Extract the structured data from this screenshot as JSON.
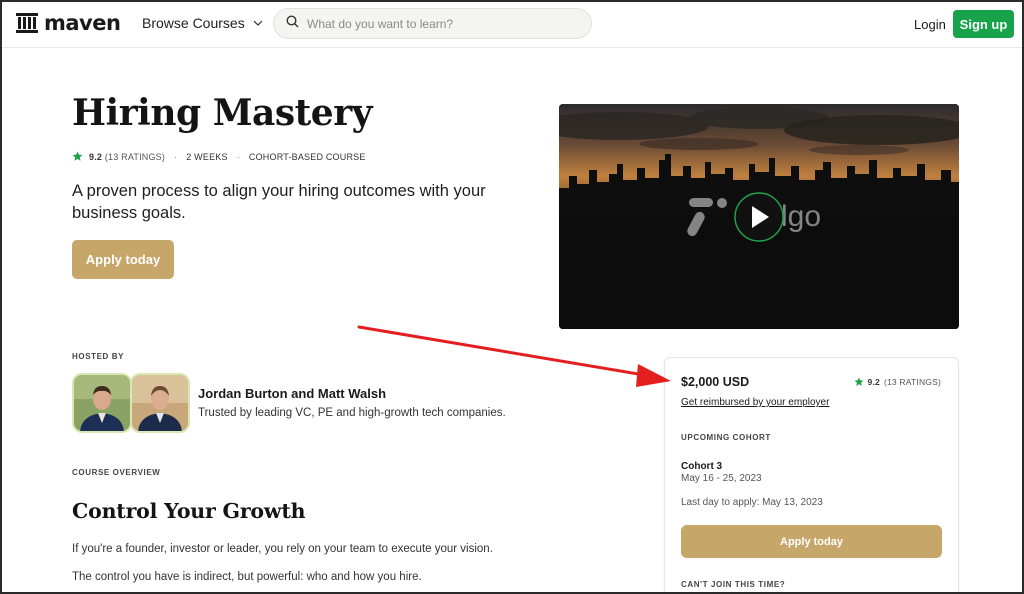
{
  "header": {
    "logo_text": "maven",
    "browse_label": "Browse Courses",
    "search_placeholder": "What do you want to learn?",
    "login_label": "Login",
    "signup_label": "Sign up"
  },
  "hero": {
    "title": "Hiring Mastery",
    "rating": "9.2",
    "ratings_count": "(13 RATINGS)",
    "duration": "2 WEEKS",
    "course_type": "COHORT-BASED COURSE",
    "subtitle": "A proven process to align your hiring outcomes with your business goals.",
    "apply_label": "Apply today"
  },
  "video": {
    "brand_text": "lgo"
  },
  "hosts": {
    "label": "HOSTED BY",
    "names": "Jordan Burton and Matt Walsh",
    "description": "Trusted by leading VC, PE and high-growth tech companies."
  },
  "overview": {
    "label": "COURSE OVERVIEW",
    "section_title": "Control Your Growth",
    "paragraph_1": "If you're a founder, investor or leader, you rely on your team to execute your vision.",
    "paragraph_2": "The control you have is indirect, but powerful: who and how you hire."
  },
  "card": {
    "price": "$2,000 USD",
    "rating": "9.2",
    "ratings_count": "(13 RATINGS)",
    "reimburse_link": "Get reimbursed by your employer",
    "upcoming_label": "UPCOMING COHORT",
    "cohort_name": "Cohort 3",
    "cohort_dates": "May 16 - 25, 2023",
    "last_day": "Last day to apply: May 13, 2023",
    "apply_label": "Apply today",
    "cant_join_label": "CAN'T JOIN THIS TIME?"
  },
  "colors": {
    "brand_green": "#16a34a",
    "apply_gold": "#c7a66a",
    "star_green": "#1fa24a",
    "annotation_red": "#e41e1e"
  },
  "icons": [
    "maven-logo-icon",
    "chevron-down-icon",
    "search-icon",
    "star-icon",
    "play-icon"
  ]
}
